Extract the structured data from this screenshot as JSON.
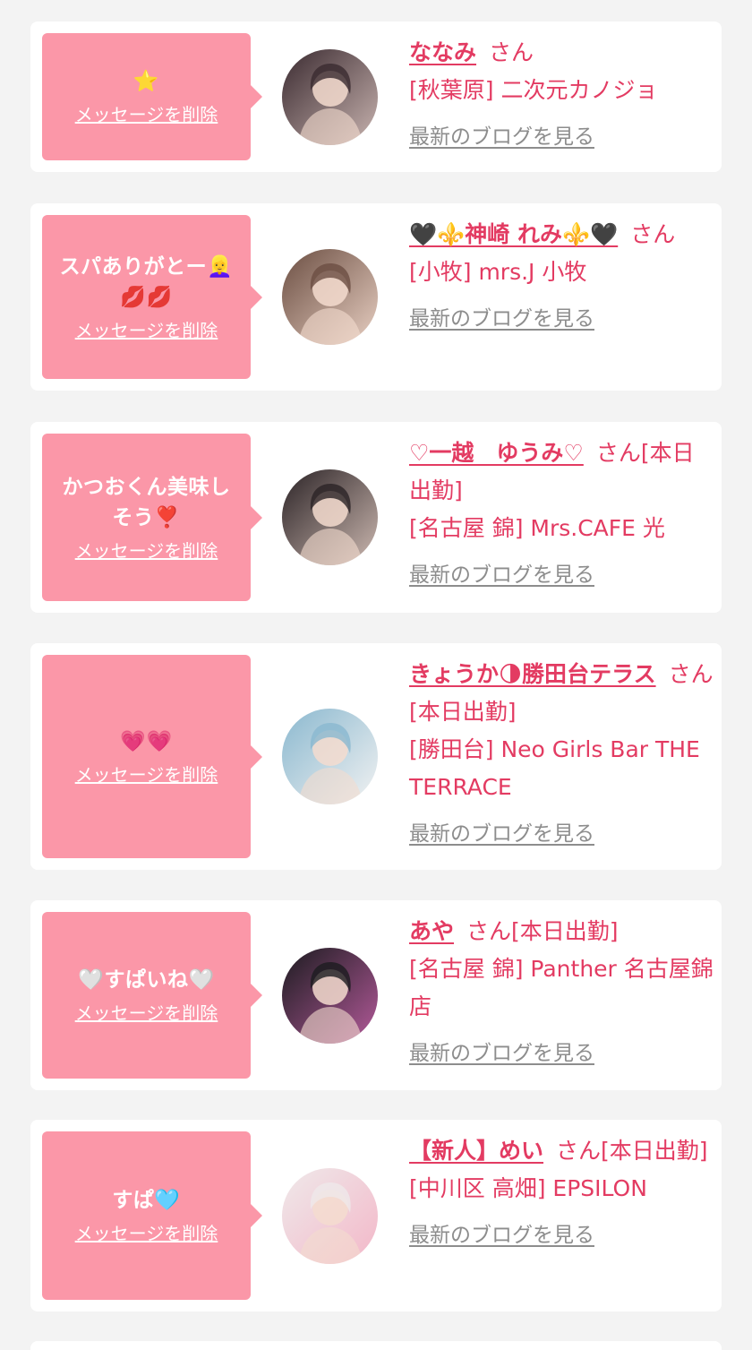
{
  "colors": {
    "bubble": "#fb97a8",
    "name": "#e33b62",
    "shop": "#e33b62",
    "blog_link": "#8d8d8d",
    "card": "#ffffff",
    "page_bg": "#f3f3f3"
  },
  "delete_label": "メッセージを削除",
  "blog_label": "最新のブログを見る",
  "items": [
    {
      "message": "⭐",
      "name": "ななみ",
      "suffix": "さん",
      "shop": "[秋葉原] 二次元カノジョ",
      "avatar_icon": "cast-photo-avatar"
    },
    {
      "message": "スパありがとー👱‍♀️\n💋💋",
      "name": "🖤⚜️神崎 れみ⚜️🖤",
      "suffix": "さん",
      "shop": "[小牧] mrs.J 小牧",
      "avatar_icon": "cast-photo-avatar"
    },
    {
      "message": "かつおくん美味し\nそう❣️",
      "name": "♡一越　ゆうみ♡",
      "suffix": "さん[本日出勤]",
      "shop": "[名古屋 錦] Mrs.CAFE 光",
      "avatar_icon": "cast-photo-avatar"
    },
    {
      "message": "💗💗",
      "name": "きょうか🌗勝田台テラス",
      "suffix": "さん[本日出勤]",
      "shop": "[勝田台] Neo Girls Bar THE TERRACE",
      "avatar_icon": "cast-photo-avatar"
    },
    {
      "message": "🤍すぱいね🤍",
      "name": "あや",
      "suffix": "さん[本日出勤]",
      "shop": "[名古屋 錦] Panther 名古屋錦店",
      "avatar_icon": "cast-photo-avatar"
    },
    {
      "message": "すぱ🩵",
      "name": "【新人】めい",
      "suffix": "さん[本日出勤]",
      "shop": "[中川区 高畑] EPSILON",
      "avatar_icon": "cast-photo-avatar"
    }
  ]
}
